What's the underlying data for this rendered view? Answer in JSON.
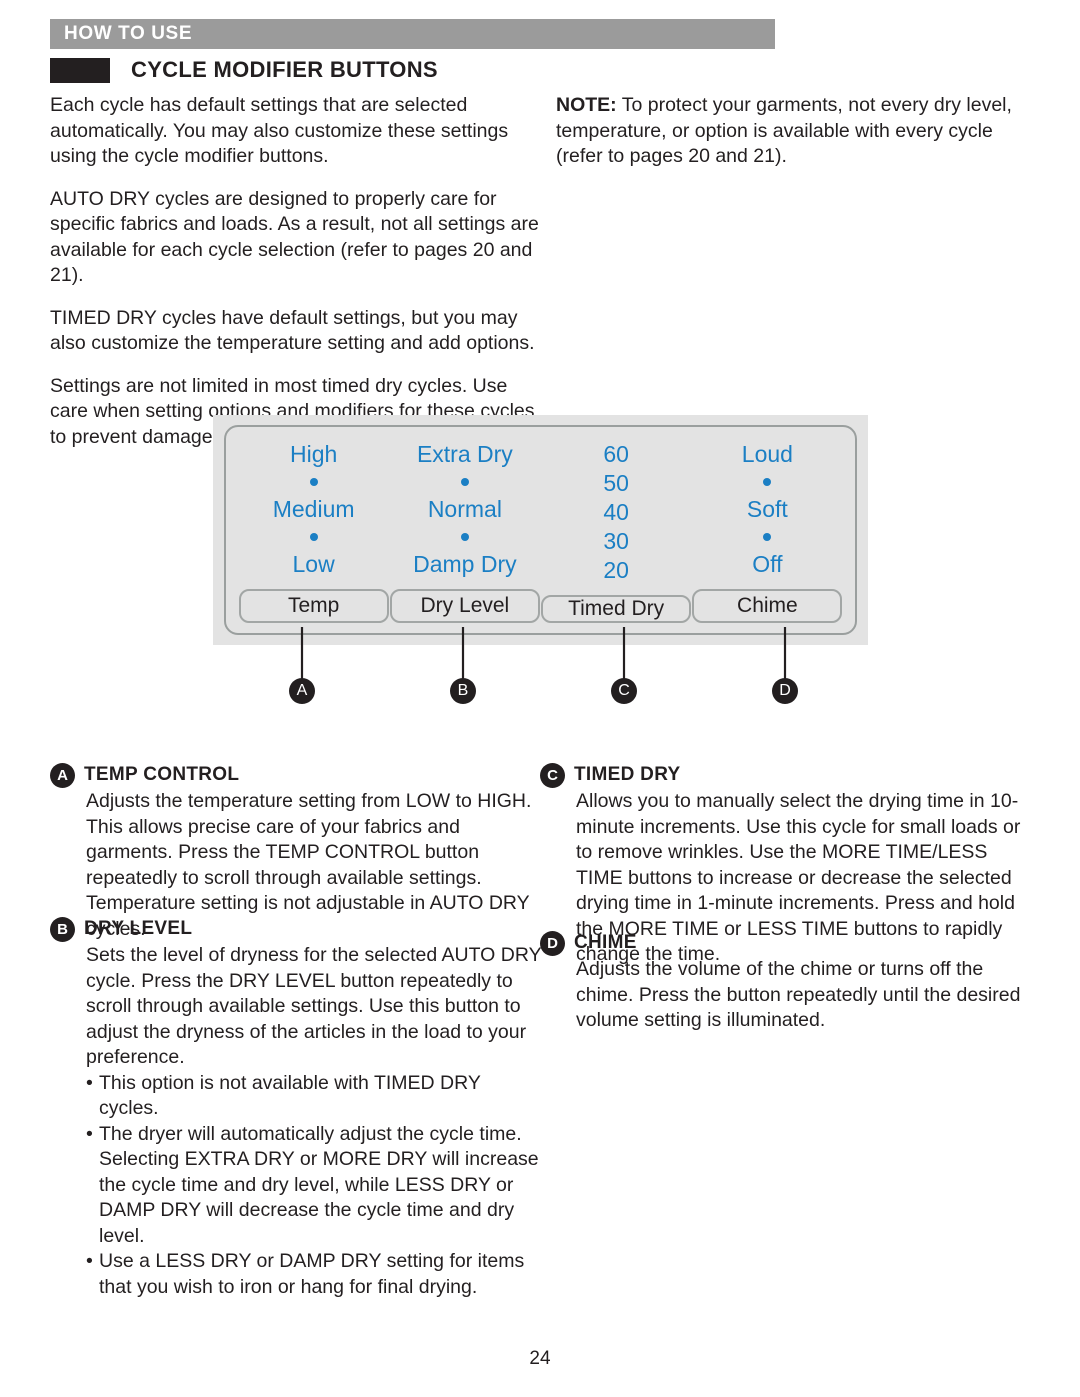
{
  "header": {
    "section_bar_label": "HOW TO USE",
    "title": "CYCLE MODIFIER BUTTONS"
  },
  "intro_left": [
    "Each cycle has default settings that are selected automatically. You may also customize these settings using the cycle modifier buttons.",
    "AUTO DRY cycles are designed to properly care for specific fabrics and loads. As a result, not all settings are available for each cycle selection (refer to pages 20 and 21).",
    "TIMED DRY cycles have default settings, but you may also customize the temperature setting and add options.",
    "Settings are not limited in most timed dry cycles. Use care when setting options and modifiers for these cycles to prevent damage to your clothing."
  ],
  "intro_right": {
    "note_label": "NOTE:",
    "note_text": " To protect your garments, not every dry level, temperature, or option is available with every cycle (refer to pages 20 and 21)."
  },
  "panel": {
    "accent_color": "#1b7fc4",
    "background_color": "#e3e3e3",
    "columns": [
      {
        "button_label": "Temp",
        "callout": "A",
        "options": [
          "High",
          "•",
          "Medium",
          "•",
          "Low"
        ]
      },
      {
        "button_label": "Dry Level",
        "callout": "B",
        "options": [
          "Extra Dry",
          "•",
          "Normal",
          "•",
          "Damp Dry"
        ]
      },
      {
        "button_label": "Timed Dry",
        "callout": "C",
        "options": [
          "60",
          "50",
          "40",
          "30",
          "20"
        ]
      },
      {
        "button_label": "Chime",
        "callout": "D",
        "options": [
          "Loud",
          "•",
          "Soft",
          "•",
          "Off"
        ]
      }
    ]
  },
  "sections": {
    "a": {
      "badge": "A",
      "title": "TEMP CONTROL",
      "body": "Adjusts the temperature setting from LOW to HIGH. This allows precise care of your fabrics and garments. Press the TEMP CONTROL button repeatedly to scroll through available settings. Temperature setting is not adjustable in AUTO DRY cycles."
    },
    "b": {
      "badge": "B",
      "title": "DRY LEVEL",
      "body": "Sets the level of dryness for the selected AUTO DRY cycle. Press the DRY LEVEL button repeatedly to scroll through available settings. Use this button to adjust the dryness of the articles in the load to your preference.",
      "bullets": [
        "This option is not available with TIMED DRY cycles.",
        "The dryer will automatically adjust the cycle time. Selecting EXTRA DRY or MORE DRY will increase the cycle time and dry level, while LESS DRY or DAMP DRY will decrease the cycle time and dry level.",
        "Use a LESS DRY or DAMP DRY setting for items that you wish to iron or hang for final drying."
      ]
    },
    "c": {
      "badge": "C",
      "title": "TIMED DRY",
      "body": "Allows you to manually select the drying time in 10-minute increments. Use this cycle for small loads or to remove wrinkles. Use the MORE TIME/LESS TIME buttons to increase or decrease the selected drying time in 1-minute increments. Press and hold the MORE TIME or LESS TIME buttons to rapidly change the time."
    },
    "d": {
      "badge": "D",
      "title": "CHIME",
      "body": "Adjusts the volume of the chime or turns off the chime. Press the button repeatedly until the desired volume setting is illuminated."
    }
  },
  "footer": {
    "page_number": "24"
  }
}
